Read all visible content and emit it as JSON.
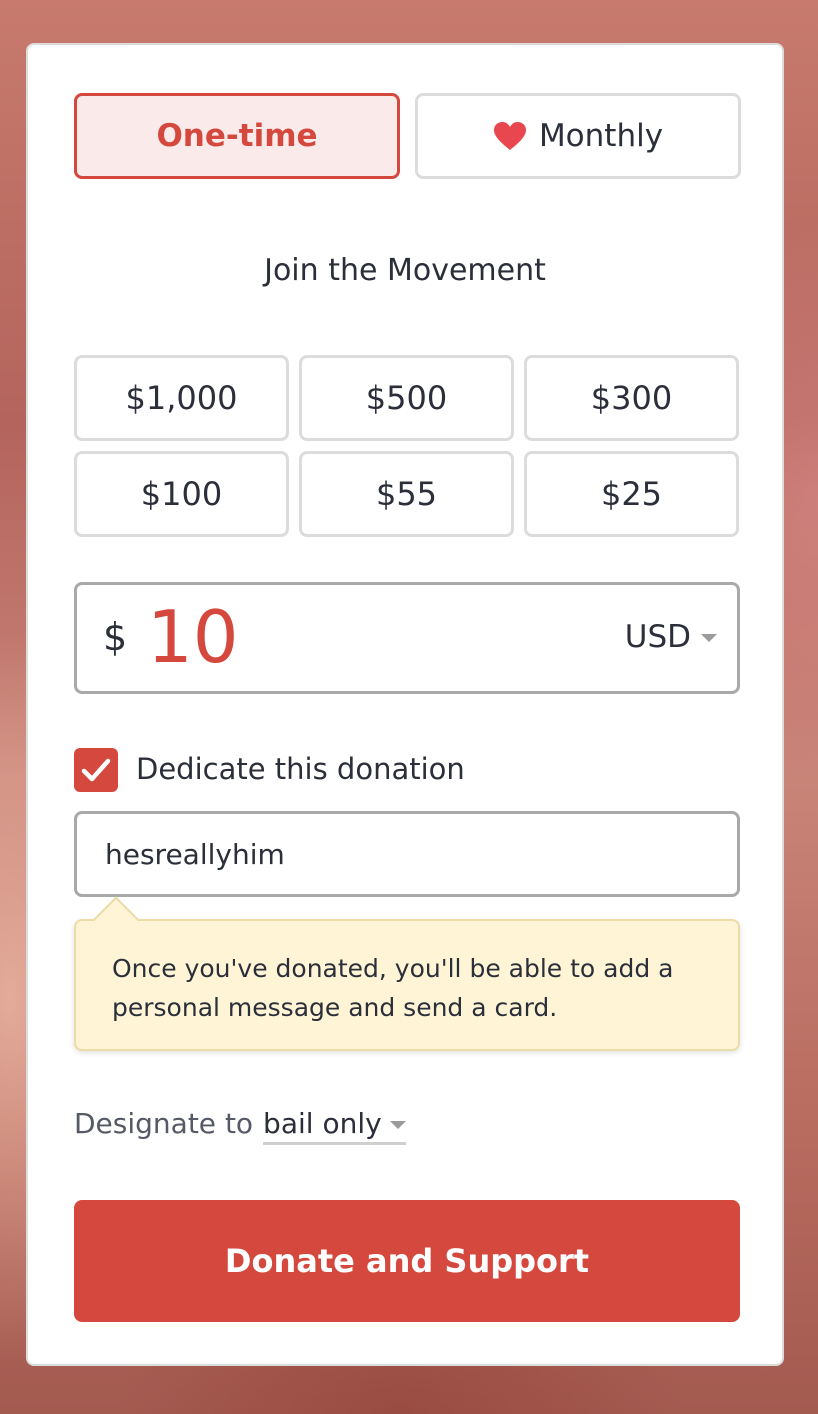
{
  "frequency": {
    "one_time_label": "One-time",
    "monthly_label": "Monthly",
    "selected": "One-time"
  },
  "subtitle": "Join the Movement",
  "amounts": [
    "$1,000",
    "$500",
    "$300",
    "$100",
    "$55",
    "$25"
  ],
  "custom_amount": {
    "currency_symbol": "$",
    "value": "10",
    "currency": "USD"
  },
  "dedication": {
    "checkbox_label": "Dedicate this donation",
    "checked": true,
    "input_value": "hesreallyhim",
    "tooltip_text": "Once you've donated, you'll be able to add a personal message and send a card."
  },
  "designation": {
    "label": "Designate to",
    "selected": "bail only"
  },
  "submit_label": "Donate and Support",
  "colors": {
    "accent": "#d5483d",
    "selected_bg": "#fbeaea",
    "tooltip_bg": "#fff5d6",
    "text": "#2b2f3a",
    "border": "#dcdcdc"
  },
  "icons": {
    "monthly": "heart-icon",
    "checkbox": "checkmark-icon",
    "dropdown": "chevron-down-icon"
  }
}
